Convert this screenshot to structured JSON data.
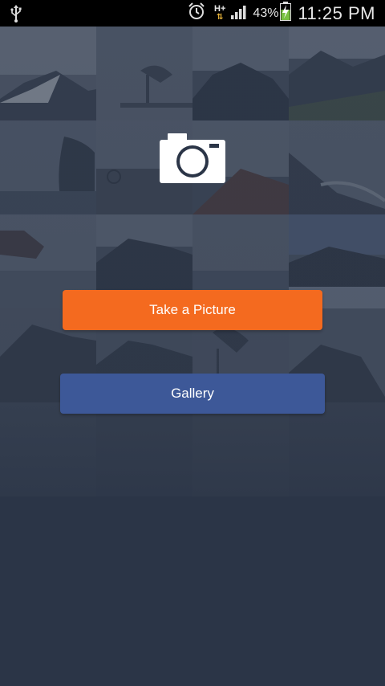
{
  "status_bar": {
    "network_type": "H+",
    "battery_percent": "43%",
    "time": "11:25 PM",
    "icons": [
      "usb-icon",
      "alarm-icon",
      "data-arrows-icon",
      "signal-icon",
      "battery-charging-icon"
    ]
  },
  "main": {
    "camera_icon": "camera-icon",
    "take_picture_label": "Take a Picture",
    "gallery_label": "Gallery"
  },
  "colors": {
    "background": "#2b3547",
    "take_picture_button": "#f46a1f",
    "gallery_button": "#3d5898",
    "status_bar": "#000000"
  }
}
